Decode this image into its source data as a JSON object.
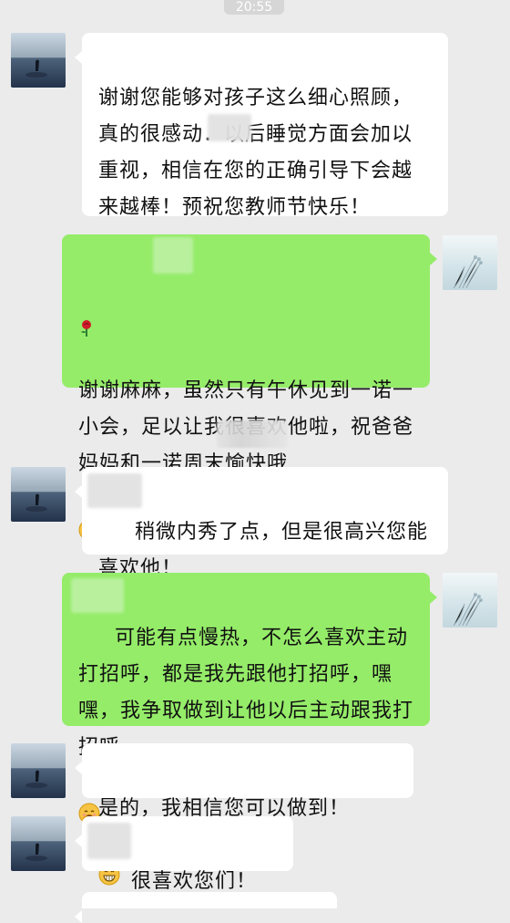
{
  "status": {
    "timestamp": "20:55"
  },
  "conversation": {
    "messages": [
      {
        "side": "left",
        "text": "谢谢您能够对孩子这么细心照顾，真的很感动．以后睡觉方面会加以重视，相信在您的正确引导下会越来越棒！预祝您教师节快乐！"
      },
      {
        "side": "right",
        "text": "谢谢麻麻，虽然只有午休见到一诺一小会，足以让我很喜欢他啦，祝爸爸妈妈和一诺周末愉快哦"
      },
      {
        "side": "left",
        "text": "稍微内秀了点，但是很高兴您能喜欢他！"
      },
      {
        "side": "right",
        "text": "可能有点慢热，不怎么喜欢主动打招呼，都是我先跟他打招呼，嘿嘿，我争取做到让他以后主动跟我打招呼"
      },
      {
        "side": "left",
        "text": "是的，我相信您可以做到！"
      },
      {
        "side": "left",
        "text": "很喜欢您们！"
      }
    ]
  }
}
